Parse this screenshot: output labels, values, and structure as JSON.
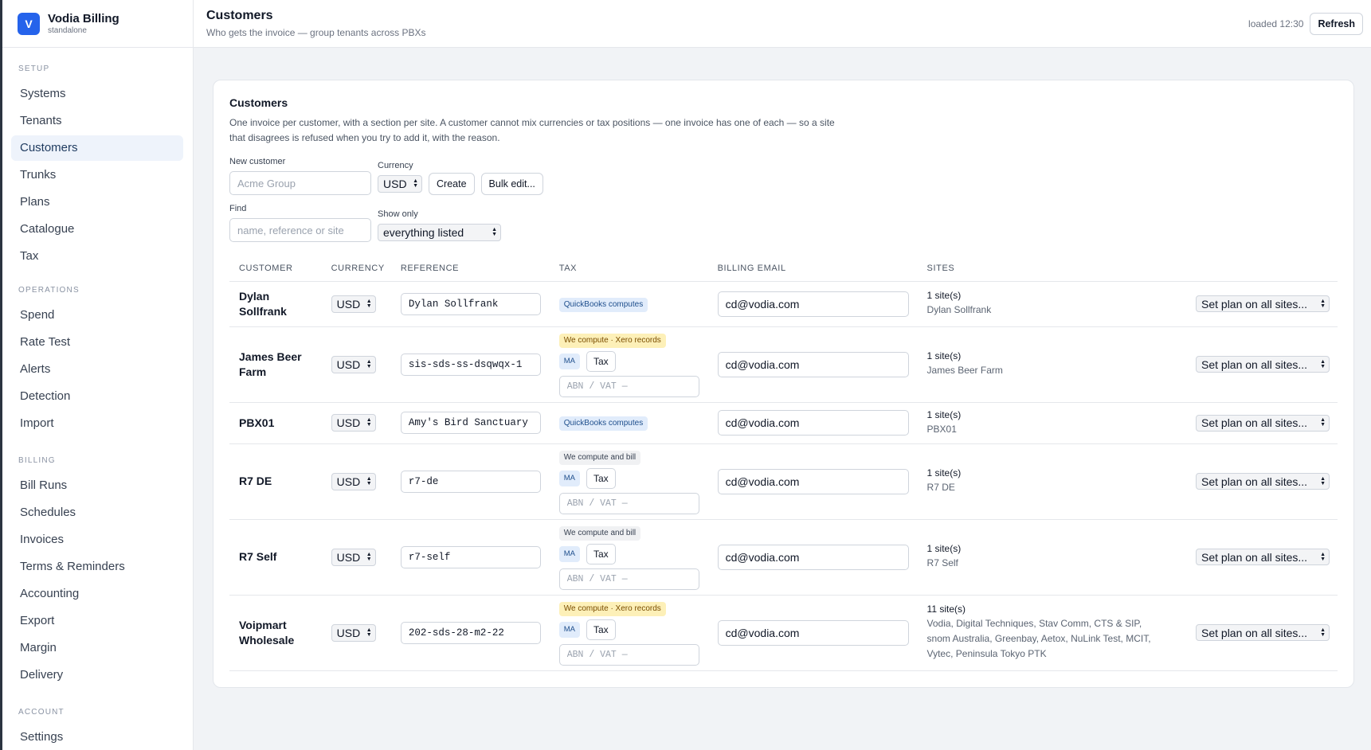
{
  "brand": {
    "logo": "V",
    "name": "Vodia Billing",
    "sub": "standalone"
  },
  "sidebar": {
    "sections": [
      {
        "heading": "SETUP",
        "items": [
          "Systems",
          "Tenants",
          "Customers",
          "Trunks",
          "Plans",
          "Catalogue",
          "Tax"
        ]
      },
      {
        "heading": "OPERATIONS",
        "items": [
          "Spend",
          "Rate Test",
          "Alerts",
          "Detection",
          "Import"
        ]
      },
      {
        "heading": "BILLING",
        "items": [
          "Bill Runs",
          "Schedules",
          "Invoices",
          "Terms & Reminders",
          "Accounting",
          "Export",
          "Margin",
          "Delivery"
        ]
      },
      {
        "heading": "ACCOUNT",
        "items": [
          "Settings"
        ]
      }
    ],
    "active": "Customers"
  },
  "header": {
    "title": "Customers",
    "subtitle": "Who gets the invoice — group tenants across PBXs",
    "loaded": "loaded 12:30",
    "refresh_label": "Refresh"
  },
  "card": {
    "title": "Customers",
    "description": "One invoice per customer, with a section per site. A customer cannot mix currencies or tax positions — one invoice has one of each — so a site that disagrees is refused when you try to add it, with the reason.",
    "new_customer": {
      "label": "New customer",
      "placeholder": "Acme Group"
    },
    "currency": {
      "label": "Currency",
      "value": "USD"
    },
    "create_label": "Create",
    "bulk_label": "Bulk edit...",
    "find": {
      "label": "Find",
      "placeholder": "name, reference or site"
    },
    "show_only": {
      "label": "Show only",
      "value": "everything listed"
    }
  },
  "table": {
    "columns": [
      "CUSTOMER",
      "CURRENCY",
      "REFERENCE",
      "TAX",
      "BILLING EMAIL",
      "SITES"
    ],
    "abn_placeholder": "ABN / VAT —",
    "ma_label": "MA",
    "tax_button_label": "Tax",
    "plan_select_label": "Set plan on all sites...",
    "rows": [
      {
        "name": "Dylan Sollfrank",
        "currency": "USD",
        "reference": "Dylan Sollfrank",
        "tax_badge": "QuickBooks computes",
        "tax_style": "blue",
        "tax_controls": false,
        "email": "cd@vodia.com",
        "sites_count": "1 site(s)",
        "sites": "Dylan Sollfrank"
      },
      {
        "name": "James Beer Farm",
        "currency": "USD",
        "reference": "sis-sds-ss-dsqwqx-1",
        "tax_badge": "We compute · Xero records",
        "tax_style": "yellow",
        "tax_controls": true,
        "email": "cd@vodia.com",
        "sites_count": "1 site(s)",
        "sites": "James Beer Farm"
      },
      {
        "name": "PBX01",
        "currency": "USD",
        "reference": "Amy's Bird Sanctuary",
        "tax_badge": "QuickBooks computes",
        "tax_style": "blue",
        "tax_controls": false,
        "email": "cd@vodia.com",
        "sites_count": "1 site(s)",
        "sites": "PBX01"
      },
      {
        "name": "R7 DE",
        "currency": "USD",
        "reference": "r7-de",
        "tax_badge": "We compute and bill",
        "tax_style": "gray",
        "tax_controls": true,
        "email": "cd@vodia.com",
        "sites_count": "1 site(s)",
        "sites": "R7 DE"
      },
      {
        "name": "R7 Self",
        "currency": "USD",
        "reference": "r7-self",
        "tax_badge": "We compute and bill",
        "tax_style": "gray",
        "tax_controls": true,
        "email": "cd@vodia.com",
        "sites_count": "1 site(s)",
        "sites": "R7 Self"
      },
      {
        "name": "Voipmart Wholesale",
        "currency": "USD",
        "reference": "202-sds-28-m2-22",
        "tax_badge": "We compute · Xero records",
        "tax_style": "yellow",
        "tax_controls": true,
        "email": "cd@vodia.com",
        "sites_count": "11 site(s)",
        "sites": "Vodia, Digital Techniques, Stav Comm, CTS & SIP, snom Australia, Greenbay, Aetox, NuLink Test, MCIT, Vytec, Peninsula Tokyo PTK"
      }
    ]
  }
}
